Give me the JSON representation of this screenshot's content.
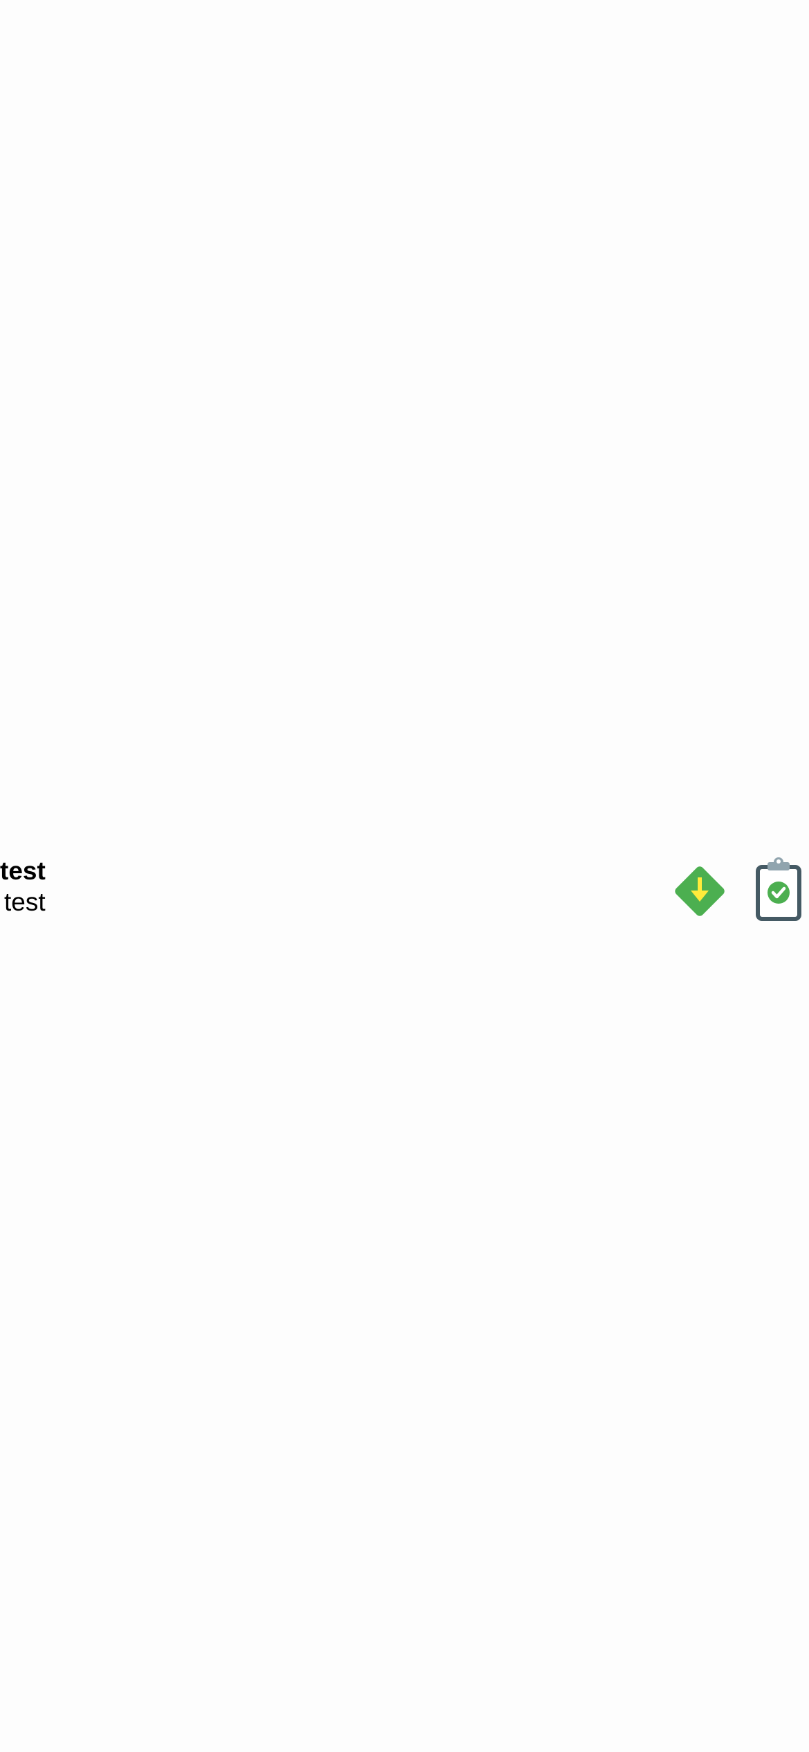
{
  "item": {
    "title": "test",
    "subtitle": "test"
  },
  "actions": [
    {
      "icon": "download-diamond-icon",
      "color": "#4caf50",
      "arrow_color": "#ffeb3b"
    },
    {
      "icon": "clipboard-check-icon",
      "frame_color": "#455a64",
      "clip_color": "#90a4ae",
      "check_color": "#4caf50"
    }
  ]
}
